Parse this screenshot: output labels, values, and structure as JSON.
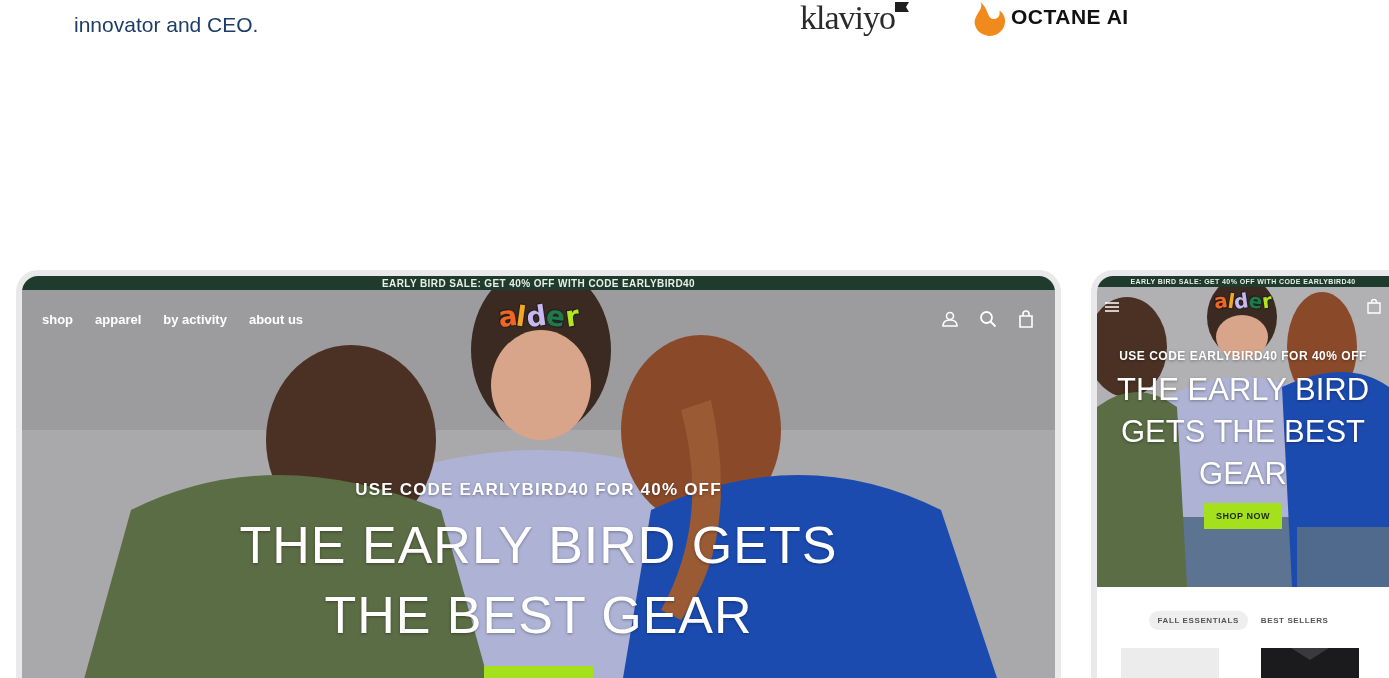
{
  "intro": {
    "text": "innovator and CEO."
  },
  "partner_logos": [
    {
      "kind": "klaviyo",
      "text": "klaviyo"
    },
    {
      "kind": "octane",
      "text": "OCTANE AI"
    }
  ],
  "desktop_preview": {
    "announcement": "EARLY BIRD SALE: GET 40% OFF WITH CODE EARLYBIRD40",
    "nav": [
      "shop",
      "apparel",
      "by activity",
      "about us"
    ],
    "logo": [
      {
        "letter": "a",
        "color": "#f26522"
      },
      {
        "letter": "l",
        "color": "#f5a623"
      },
      {
        "letter": "d",
        "color": "#c9b8f0"
      },
      {
        "letter": "e",
        "color": "#1f7a4a"
      },
      {
        "letter": "r",
        "color": "#b5e61d"
      }
    ],
    "eyebrow": "USE CODE EARLYBIRD40 FOR 40% OFF",
    "headline": [
      "THE EARLY BIRD GETS",
      "THE BEST GEAR"
    ]
  },
  "mobile_preview": {
    "announcement": "EARLY BIRD SALE: GET 40% OFF WITH CODE EARLYBIRD40",
    "logo": [
      {
        "letter": "a",
        "color": "#f26522"
      },
      {
        "letter": "l",
        "color": "#f5a623"
      },
      {
        "letter": "d",
        "color": "#c9b8f0"
      },
      {
        "letter": "e",
        "color": "#1f7a4a"
      },
      {
        "letter": "r",
        "color": "#b5e61d"
      }
    ],
    "eyebrow": "USE CODE EARLYBIRD40 FOR 40% OFF",
    "headline": [
      "THE EARLY BIRD",
      "GETS THE BEST",
      "GEAR"
    ],
    "button": "SHOP NOW",
    "tabs": [
      {
        "label": "FALL ESSENTIALS",
        "selected": true
      },
      {
        "label": "BEST SELLERS",
        "selected": false
      }
    ],
    "products": [
      {
        "kind": "light"
      },
      {
        "kind": "dark"
      }
    ]
  }
}
